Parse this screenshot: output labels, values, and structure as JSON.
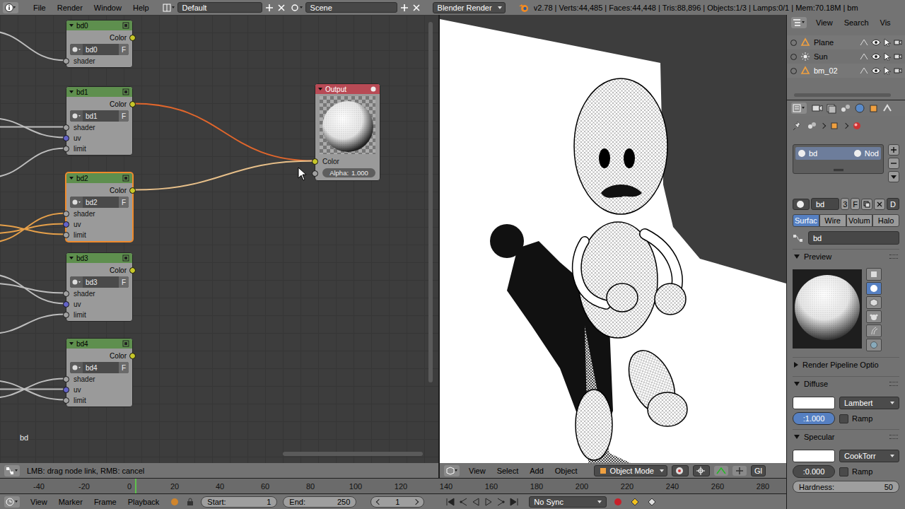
{
  "top_bar": {
    "menus": [
      "File",
      "Render",
      "Window",
      "Help"
    ],
    "layout": "Default",
    "scene": "Scene",
    "engine": "Blender Render",
    "stats": "v2.78 | Verts:44,485 | Faces:44,448 | Tris:88,896 | Objects:1/3 | Lamps:0/1 | Mem:70.18M | bm"
  },
  "node_editor": {
    "nodes": [
      {
        "title": "bd0",
        "output": "Color",
        "datablock": "bd0",
        "fake_user": "F",
        "selected": false,
        "inputs": [
          {
            "name": "shader",
            "kind": "shader"
          }
        ]
      },
      {
        "title": "bd1",
        "output": "Color",
        "datablock": "bd1",
        "fake_user": "F",
        "selected": false,
        "inputs": [
          {
            "name": "shader",
            "kind": "shader"
          },
          {
            "name": "uv",
            "kind": "vector"
          },
          {
            "name": "limit",
            "kind": "value"
          }
        ]
      },
      {
        "title": "bd2",
        "output": "Color",
        "datablock": "bd2",
        "fake_user": "F",
        "selected": true,
        "inputs": [
          {
            "name": "shader",
            "kind": "shader"
          },
          {
            "name": "uv",
            "kind": "vector"
          },
          {
            "name": "limit",
            "kind": "value"
          }
        ]
      },
      {
        "title": "bd3",
        "output": "Color",
        "datablock": "bd3",
        "fake_user": "F",
        "selected": false,
        "inputs": [
          {
            "name": "shader",
            "kind": "shader"
          },
          {
            "name": "uv",
            "kind": "vector"
          },
          {
            "name": "limit",
            "kind": "value"
          }
        ]
      },
      {
        "title": "bd4",
        "output": "Color",
        "datablock": "bd4",
        "fake_user": "F",
        "selected": false,
        "inputs": [
          {
            "name": "shader",
            "kind": "shader"
          },
          {
            "name": "uv",
            "kind": "vector"
          },
          {
            "name": "limit",
            "kind": "value"
          }
        ]
      }
    ],
    "output_node": {
      "title": "Output",
      "color_input": "Color",
      "alpha_label": "Alpha:",
      "alpha_value": "1.000"
    },
    "links": [
      {
        "from": "bd1",
        "to": "Output",
        "dragging": true
      },
      {
        "from": "bd2",
        "to": "Output",
        "dragging": false
      }
    ],
    "tree_name": "bd",
    "status": "LMB: drag node link, RMB: cancel"
  },
  "viewport": {
    "menus": [
      "View",
      "Select",
      "Add",
      "Object"
    ],
    "mode": "Object Mode",
    "orientation": "Gl"
  },
  "outliner": {
    "menus": [
      "View",
      "Search",
      "Vis"
    ],
    "items": [
      {
        "name": "Plane",
        "kind": "mesh",
        "selected": false
      },
      {
        "name": "Sun",
        "kind": "lamp",
        "selected": false
      },
      {
        "name": "bm_02",
        "kind": "mesh",
        "selected": true
      }
    ]
  },
  "properties": {
    "slot": {
      "name": "bd",
      "node": "Nod"
    },
    "material": {
      "name": "bd",
      "users": "3",
      "fake_user": "F",
      "link": "D"
    },
    "tabs": [
      {
        "label": "Surfac",
        "selected": true
      },
      {
        "label": "Wire",
        "selected": false
      },
      {
        "label": "Volum",
        "selected": false
      },
      {
        "label": "Halo",
        "selected": false
      }
    ],
    "node_material": "bd",
    "preview": {
      "title": "Preview",
      "expanded": true,
      "shapes": [
        {
          "kind": "plane",
          "selected": false
        },
        {
          "kind": "sphere",
          "selected": true
        },
        {
          "kind": "cube",
          "selected": false
        },
        {
          "kind": "monkey",
          "selected": false
        },
        {
          "kind": "hair",
          "selected": false
        },
        {
          "kind": "sky",
          "selected": false
        }
      ]
    },
    "pipeline": {
      "title": "Render Pipeline Optio",
      "expanded": false
    },
    "diffuse": {
      "title": "Diffuse",
      "expanded": true,
      "color": "#ffffff",
      "shader": "Lambert",
      "intensity": ":1.000",
      "level": 1,
      "ramp_label": "Ramp",
      "ramp": false
    },
    "specular": {
      "title": "Specular",
      "expanded": true,
      "color": "#ffffff",
      "shader": "CookTorr",
      "intensity": ":0.000",
      "level": 0,
      "ramp_label": "Ramp",
      "ramp": false,
      "hardness": "Hardness:",
      "hardness_value": "50"
    }
  },
  "timeline": {
    "ticks": [
      "-40",
      "-20",
      "0",
      "20",
      "40",
      "60",
      "80",
      "100",
      "120",
      "140",
      "160",
      "180",
      "200",
      "220",
      "240",
      "260",
      "280"
    ],
    "menus": [
      "View",
      "Marker",
      "Frame",
      "Playback"
    ],
    "start_label": "Start:",
    "start": "1",
    "end_label": "End:",
    "end": "250",
    "current": "1",
    "sync": "No Sync"
  }
}
